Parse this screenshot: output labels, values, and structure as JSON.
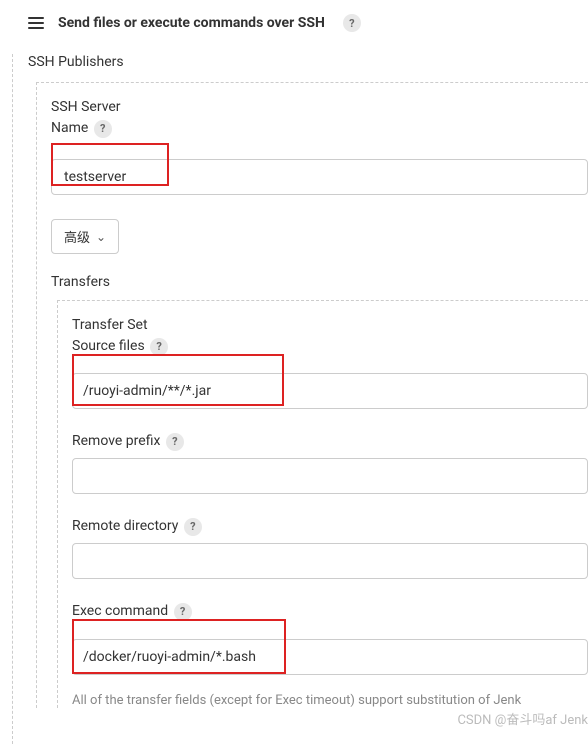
{
  "header": {
    "title": "Send files or execute commands over SSH"
  },
  "publishers_label": "SSH Publishers",
  "server": {
    "label_ssh": "SSH Server",
    "label_name": "Name",
    "name_value": "testserver",
    "advanced_label": "高级"
  },
  "transfers": {
    "label": "Transfers",
    "set_label": "Transfer Set",
    "source_files": {
      "label": "Source files",
      "value": "/ruoyi-admin/**/*.jar"
    },
    "remove_prefix": {
      "label": "Remove prefix",
      "value": ""
    },
    "remote_directory": {
      "label": "Remote directory",
      "value": ""
    },
    "exec_command": {
      "label": "Exec command",
      "value": "/docker/ruoyi-admin/*.bash"
    },
    "footer_note": "All of the transfer fields (except for Exec timeout) support substitution of Jenk"
  },
  "watermark": "CSDN @奋斗吗af Jenk"
}
